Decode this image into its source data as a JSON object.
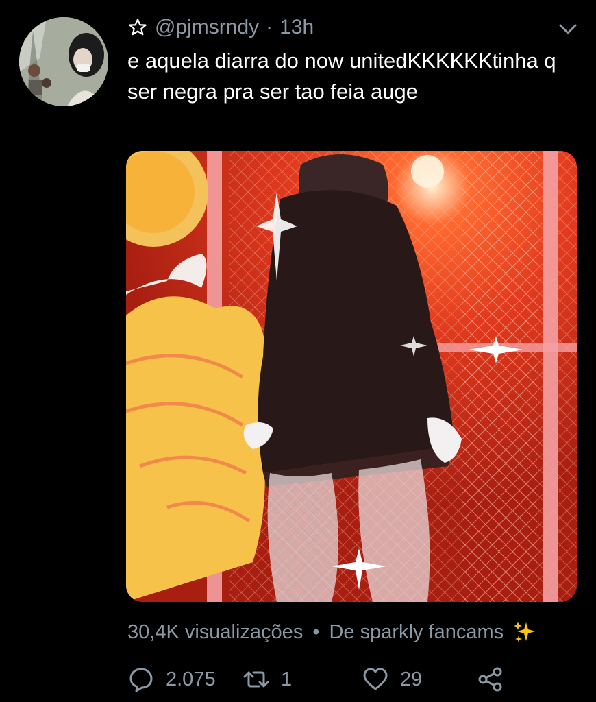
{
  "tweet": {
    "username": "@pjmsrndy",
    "separator": "·",
    "time": "13h",
    "text": "e aquela diarra do now unitedKKKKKKtinha q ser negra pra ser tao feia auge",
    "views": "30,4K visualizações",
    "meta_dot": "•",
    "source": "De sparkly fancams",
    "replies": "2.075",
    "retweets": "1",
    "likes": "29"
  },
  "icons": {
    "favorite_star": "star-outline-icon",
    "menu": "chevron-down-icon",
    "reply": "speech-bubble-icon",
    "retweet": "retweet-icon",
    "like": "heart-icon",
    "share": "share-icon",
    "sparkles": "sparkles-emoji"
  },
  "colors": {
    "background": "#000000",
    "text": "#ffffff",
    "secondary": "#8b98a5",
    "media_red": "#c72a18"
  }
}
